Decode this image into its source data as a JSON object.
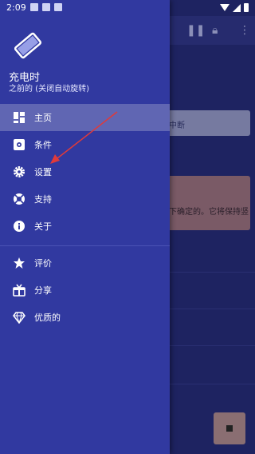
{
  "status_bar": {
    "time": "2:09"
  },
  "app_behind": {
    "card1_text": "中断",
    "card2_text": "下确定的。它将保持竖"
  },
  "drawer": {
    "title": "充电时",
    "subtitle": "之前的 (关闭自动旋转)",
    "menu_items": [
      {
        "label": "主页",
        "icon": "dashboard-icon",
        "active": true
      },
      {
        "label": "条件",
        "icon": "settings-box-icon"
      },
      {
        "label": "设置",
        "icon": "gear-icon"
      },
      {
        "label": "支持",
        "icon": "lifebuoy-icon"
      },
      {
        "label": "关于",
        "icon": "info-icon"
      },
      {
        "label": "评价",
        "icon": "star-icon"
      },
      {
        "label": "分享",
        "icon": "gift-icon"
      },
      {
        "label": "优质的",
        "icon": "diamond-icon"
      }
    ]
  },
  "colors": {
    "drawer_bg": "#3139a0",
    "active_item_bg": "#6066b3",
    "annotation_arrow": "#e03a3a"
  }
}
